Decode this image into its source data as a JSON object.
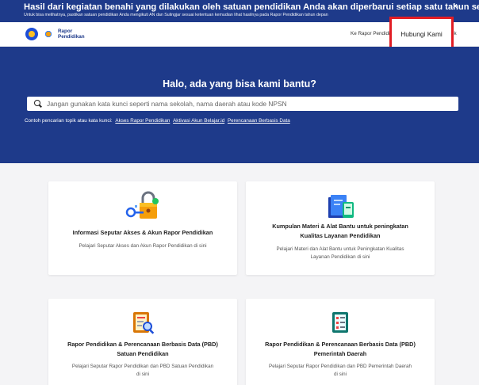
{
  "banner": {
    "title": "Hasil dari kegiatan benahi yang dilakukan oleh satuan pendidikan Anda akan diperbarui setiap satu tahun sekali",
    "subtitle": "Untuk bisa melihatnya, pastikan satuan pendidikan Anda mengikuti AN dan Sulingjar sesuai ketentuan kemudian lihat hasilnya pada Rapor Pendidikan tahun depan",
    "close": "×"
  },
  "header": {
    "logo_line1": "Rapor",
    "logo_line2": "Pendidikan",
    "nav_link": "Ke Rapor Pendidikan",
    "nav_link2": "uk",
    "contact_button": "Hubungi Kami"
  },
  "hero": {
    "title": "Halo, ada yang bisa kami bantu?",
    "search_placeholder": "Jangan gunakan kata kunci seperti nama sekolah, nama daerah atau kode NPSN",
    "examples_label": "Contoh pencarian topik atau kata kunci:",
    "examples": [
      "Akses Rapor Pendidikan",
      "Aktivasi Akun Belajar.id",
      "Perencanaan Berbasis Data"
    ]
  },
  "cards": [
    {
      "title": "Informasi Seputar Akses & Akun Rapor Pendidikan",
      "desc": "Pelajari Seputar Akses dan Akun Rapor Pendidikan di sini"
    },
    {
      "title": "Kumpulan Materi & Alat Bantu untuk peningkatan Kualitas Layanan Pendidikan",
      "desc": "Pelajari Materi dan Alat Bantu untuk Peningkatan Kualitas Layanan Pendidikan di sini"
    },
    {
      "title": "Rapor Pendidikan & Perencanaan Berbasis Data (PBD) Satuan Pendidikan",
      "desc": "Pelajari Seputar Rapor Pendidikan dan PBD Satuan Pendidikan di sini"
    },
    {
      "title": "Rapor Pendidikan & Perencanaan Berbasis Data (PBD) Pemerintah Daerah",
      "desc": "Pelajari Seputar Rapor Pendidikan dan PBD Pemerintah Daerah di sini"
    }
  ],
  "colors": {
    "brand_blue": "#1e3a8a",
    "highlight_red": "#e11d24"
  }
}
